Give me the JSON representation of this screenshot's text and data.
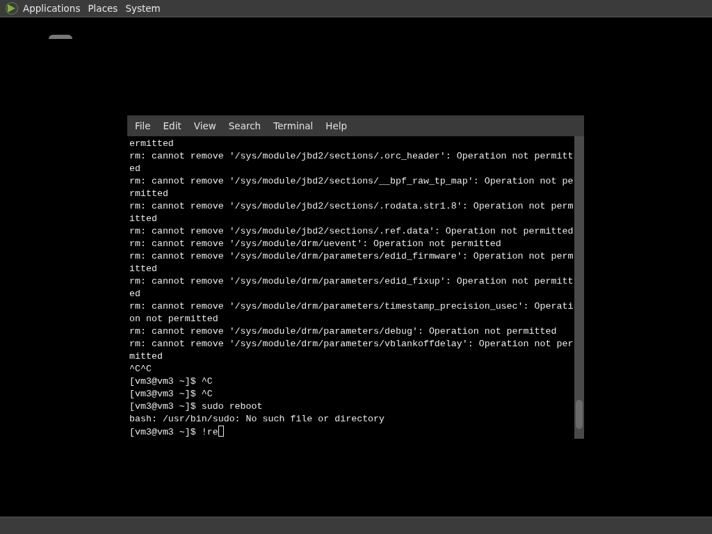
{
  "top_panel": {
    "menus": [
      "Applications",
      "Places",
      "System"
    ]
  },
  "terminal": {
    "menu": [
      "File",
      "Edit",
      "View",
      "Search",
      "Terminal",
      "Help"
    ],
    "lines": [
      "ermitted",
      "rm: cannot remove '/sys/module/jbd2/sections/.orc_header': Operation not permitt",
      "ed",
      "rm: cannot remove '/sys/module/jbd2/sections/__bpf_raw_tp_map': Operation not pe",
      "rmitted",
      "rm: cannot remove '/sys/module/jbd2/sections/.rodata.str1.8': Operation not perm",
      "itted",
      "rm: cannot remove '/sys/module/jbd2/sections/.ref.data': Operation not permitted",
      "rm: cannot remove '/sys/module/drm/uevent': Operation not permitted",
      "rm: cannot remove '/sys/module/drm/parameters/edid_firmware': Operation not perm",
      "itted",
      "rm: cannot remove '/sys/module/drm/parameters/edid_fixup': Operation not permitt",
      "ed",
      "rm: cannot remove '/sys/module/drm/parameters/timestamp_precision_usec': Operati",
      "on not permitted",
      "rm: cannot remove '/sys/module/drm/parameters/debug': Operation not permitted",
      "rm: cannot remove '/sys/module/drm/parameters/vblankoffdelay': Operation not per",
      "mitted",
      "^C^C",
      "[vm3@vm3 ~]$ ^C",
      "[vm3@vm3 ~]$ ^C",
      "[vm3@vm3 ~]$ sudo reboot",
      "bash: /usr/bin/sudo: No such file or directory"
    ],
    "input_line": {
      "text": "[vm3@vm3 ~]$ !re",
      "cursor": true
    }
  }
}
